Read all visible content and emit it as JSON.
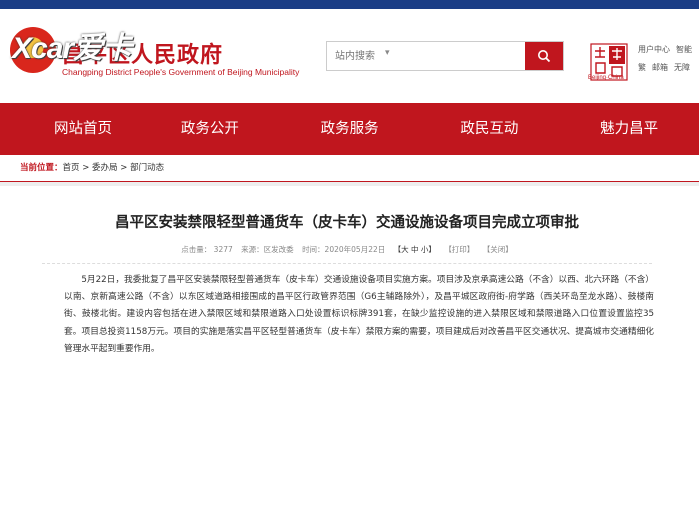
{
  "header": {
    "site_name_cn": "昌平区人民政府",
    "site_name_en": "Changping District People's Government of Beijing Municipality",
    "watermark": "Xcar爱卡",
    "search_placeholder": "站内搜索",
    "search_caret": "▾",
    "seal_text": "Beijing·China",
    "top_links": [
      "用户中心",
      "智能",
      "繁",
      "邮箱",
      "无障"
    ]
  },
  "nav": {
    "items": [
      "网站首页",
      "政务公开",
      "政务服务",
      "政民互动",
      "魅力昌平"
    ]
  },
  "breadcrumb": {
    "lead": "当前位置：",
    "path": "首页 > 委办局 > 部门动态"
  },
  "article": {
    "title": "昌平区安装禁限轻型普通货车（皮卡车）交通设施设备项目完成立项审批",
    "meta": {
      "views": "点击量： 3277",
      "source": "来源：区发改委",
      "time": "时间：2020年05月22日",
      "font_size": "【大 中 小】",
      "print": "【打印】",
      "close": "【关闭】"
    },
    "body": "5月22日，我委批复了昌平区安装禁限轻型普通货车（皮卡车）交通设施设备项目实施方案。项目涉及京承高速公路（不含）以西、北六环路（不含）以南、京新高速公路（不含）以东区域道路相接围成的昌平区行政管界范围（G6主辅路除外），及昌平城区政府街-府学路（西关环岛至龙水路）、鼓楼南街、鼓楼北街。建设内容包括在进入禁限区域和禁限道路入口处设置标识标牌391套，在缺少监控设施的进入禁限区域和禁限道路入口位置设置监控35套。项目总投资1158万元。项目的实施是落实昌平区轻型普通货车（皮卡车）禁限方案的需要，项目建成后对改善昌平区交通状况、提高城市交通精细化管理水平起到重要作用。"
  },
  "colors": {
    "brand_red": "#c0161e",
    "outer_blue": "#1b3e86"
  }
}
